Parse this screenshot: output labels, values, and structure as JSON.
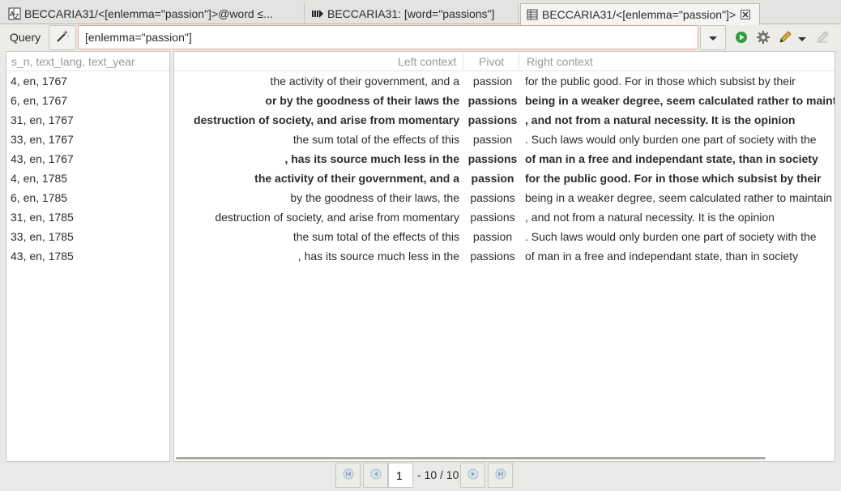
{
  "tabs": [
    {
      "icon": "az-index-icon",
      "label": "BECCARIA31/<[enlemma=\"passion\"]>@word ≤..."
    },
    {
      "icon": "concordance-icon",
      "label": "BECCARIA31: [word=\"passions\"]"
    },
    {
      "icon": "table-icon",
      "label": "BECCARIA31/<[enlemma=\"passion\"]>",
      "active": true
    }
  ],
  "query": {
    "label": "Query",
    "value": "[enlemma=\"passion\"]"
  },
  "colors": {
    "input_border": "#e8a38e",
    "go": "#2e9e3a",
    "edit": "#e0a82e"
  },
  "left_panel": {
    "header": "s_n, text_lang, text_year",
    "rows": [
      "4, en, 1767",
      "6, en, 1767",
      "31, en, 1767",
      "33, en, 1767",
      "43, en, 1767",
      "4, en, 1785",
      "6, en, 1785",
      "31, en, 1785",
      "33, en, 1785",
      "43, en, 1785"
    ]
  },
  "concordance": {
    "headers": {
      "left": "Left context",
      "pivot": "Pivot",
      "right": "Right context"
    },
    "rows": [
      {
        "left": "the activity of their government, and a",
        "pivot": "passion",
        "right": "for the public good. For in those which subsist by their",
        "bold": false
      },
      {
        "left": "or by the goodness of their laws the",
        "pivot": "passions",
        "right": "being in a weaker degree, seem calculated rather to maintain",
        "bold": true
      },
      {
        "left": "destruction of society, and arise from momentary",
        "pivot": "passions",
        "right": ", and not from a natural necessity. It is the opinion",
        "bold": true
      },
      {
        "left": "the sum total of the effects of this",
        "pivot": "passion",
        "right": ". Such laws would only burden one part of society with the",
        "bold": false
      },
      {
        "left": ", has its source much less in the",
        "pivot": "passions",
        "right": "of man in a free and independant state, than in society",
        "bold": true
      },
      {
        "left": "the activity of their government, and a",
        "pivot": "passion",
        "right": "for the public good. For in those which subsist by their",
        "bold": true
      },
      {
        "left": "by the goodness of their laws, the",
        "pivot": "passions",
        "right": "being in a weaker degree, seem calculated rather to maintain",
        "bold": false
      },
      {
        "left": "destruction of society, and arise from momentary",
        "pivot": "passions",
        "right": ", and not from a natural necessity. It is the opinion",
        "bold": false
      },
      {
        "left": "the sum total of the effects of this",
        "pivot": "passion",
        "right": ". Such laws would only burden one part of society with the",
        "bold": false
      },
      {
        "left": ", has its source much less in the",
        "pivot": "passions",
        "right": "of man in a free and independant state, than in society",
        "bold": false
      }
    ]
  },
  "pagination": {
    "page": "1",
    "range": "- 10 / 10"
  }
}
